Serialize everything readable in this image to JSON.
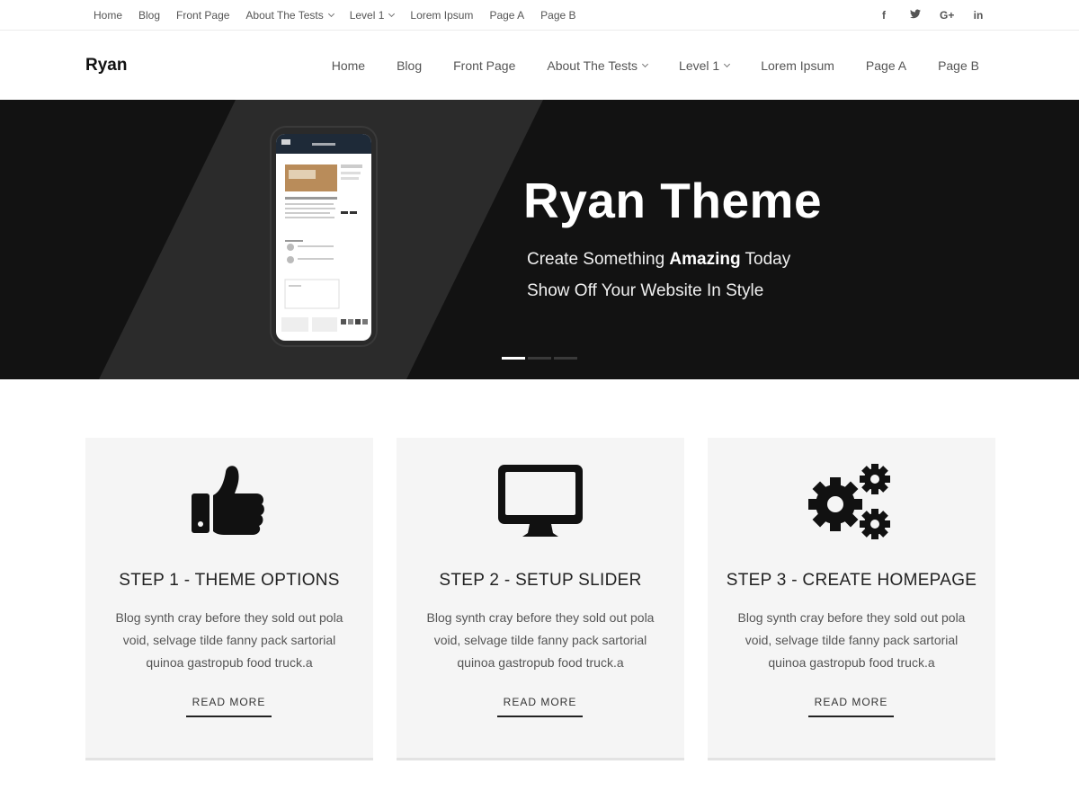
{
  "topbar": {
    "nav": [
      {
        "label": "Home"
      },
      {
        "label": "Blog"
      },
      {
        "label": "Front Page"
      },
      {
        "label": "About The Tests"
      },
      {
        "label": "Level 1"
      },
      {
        "label": "Lorem Ipsum"
      },
      {
        "label": "Page A"
      },
      {
        "label": "Page B"
      }
    ],
    "social": [
      {
        "icon": "facebook-icon",
        "glyph": "f"
      },
      {
        "icon": "twitter-icon",
        "glyph": "t"
      },
      {
        "icon": "google-plus-icon",
        "glyph": "G+"
      },
      {
        "icon": "linkedin-icon",
        "glyph": "in"
      }
    ]
  },
  "header": {
    "site_title": "Ryan",
    "nav": [
      {
        "label": "Home"
      },
      {
        "label": "Blog"
      },
      {
        "label": "Front Page"
      },
      {
        "label": "About The Tests"
      },
      {
        "label": "Level 1"
      },
      {
        "label": "Lorem Ipsum"
      },
      {
        "label": "Page A"
      },
      {
        "label": "Page B"
      }
    ]
  },
  "hero": {
    "title": "Ryan Theme",
    "line1_pre": "Create Something ",
    "line1_bold": "Amazing",
    "line1_post": " Today",
    "line2": "Show Off Your Website In Style",
    "slides_count": 3,
    "active_slide": 1
  },
  "features": [
    {
      "icon": "thumbs-up-icon",
      "title": "STEP 1 - THEME OPTIONS",
      "text": "Blog synth cray before they sold out pola void, selvage tilde fanny pack sartorial quinoa gastropub food truck.a",
      "link": "READ MORE"
    },
    {
      "icon": "desktop-monitor-icon",
      "title": "STEP 2 - SETUP SLIDER",
      "text": "Blog synth cray before they sold out pola void, selvage tilde fanny pack sartorial quinoa gastropub food truck.a",
      "link": "READ MORE"
    },
    {
      "icon": "gears-icon",
      "title": "STEP 3 - CREATE HOMEPAGE",
      "text": "Blog synth cray before they sold out pola void, selvage tilde fanny pack sartorial quinoa gastropub food truck.a",
      "link": "READ MORE"
    }
  ],
  "colors": {
    "hero_bg": "#121212",
    "hero_band": "#2b2b2b",
    "card_bg": "#f5f5f5",
    "text": "#222222",
    "muted": "#555555"
  }
}
